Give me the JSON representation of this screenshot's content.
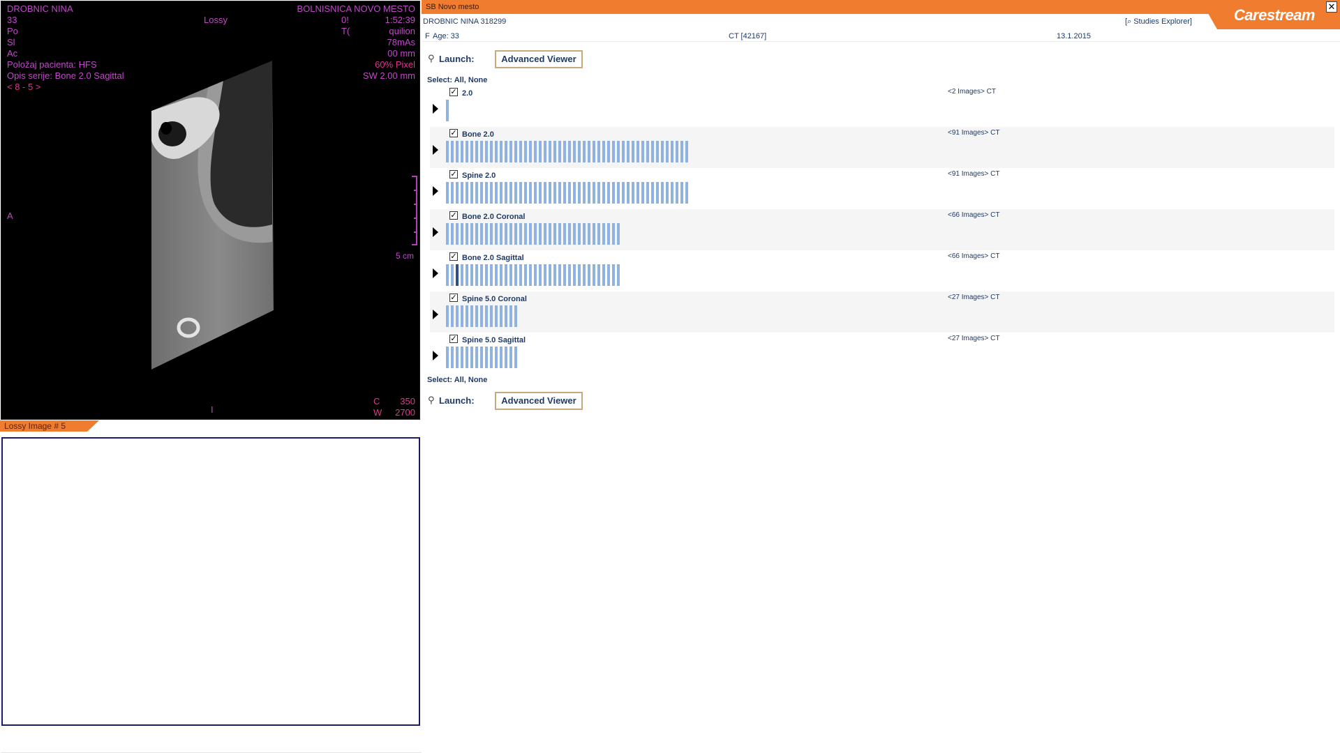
{
  "viewer": {
    "top_left": [
      "DROBNIC NINA",
      "33",
      "Po",
      "Sl",
      "Ac",
      "Položaj pacienta: HFS",
      "Opis serije: Bone 2.0 Sagittal"
    ],
    "nav": "< 8 - 5 >",
    "top_center": "Lossy",
    "top_center2": [
      "0!",
      "T("
    ],
    "top_right": [
      "BOLNISNICA NOVO MESTO",
      "1:52:39",
      "quilion",
      "78mAs",
      "00 mm",
      "60% Pixel",
      "SW 2.00 mm"
    ],
    "mid_left": "A",
    "bottom_center": "I",
    "scale_label": "5 cm",
    "window": [
      {
        "key": "C",
        "value": "350"
      },
      {
        "key": "W",
        "value": "2700"
      }
    ],
    "lossy_tab": "Lossy Image # 5"
  },
  "panel": {
    "site_name": "SB Novo mesto",
    "logo": "Carestream",
    "close_glyph": "✕",
    "patient_line": "DROBNIC NINA  318299",
    "studies_explorer": "[⌕ Studies Explorer]",
    "sex": "F",
    "age": "Age: 33",
    "modality": "CT [42167]",
    "study_date": "13.1.2015",
    "launch_label": "Launch:",
    "advanced_viewer": "Advanced Viewer",
    "select_all_none": "Select: All, None",
    "series": [
      {
        "name": "2.0",
        "count": "<2 Images> CT",
        "images": 2,
        "checked": true
      },
      {
        "name": "Bone 2.0",
        "count": "<91 Images> CT",
        "images": 91,
        "checked": true
      },
      {
        "name": "Spine 2.0",
        "count": "<91 Images> CT",
        "images": 91,
        "checked": true
      },
      {
        "name": "Bone 2.0 Coronal",
        "count": "<66 Images> CT",
        "images": 66,
        "checked": true
      },
      {
        "name": "Bone 2.0 Sagittal",
        "count": "<66 Images> CT",
        "images": 66,
        "checked": true
      },
      {
        "name": "Spine 5.0 Coronal",
        "count": "<27 Images> CT",
        "images": 27,
        "checked": true
      },
      {
        "name": "Spine 5.0 Sagittal",
        "count": "<27 Images> CT",
        "images": 27,
        "checked": true
      }
    ]
  },
  "colors": {
    "accent_orange": "#f07c30",
    "overlay_magenta": "#c04ac9",
    "text_navy": "#1f3a66",
    "strip_blue": "#8fb3de"
  }
}
